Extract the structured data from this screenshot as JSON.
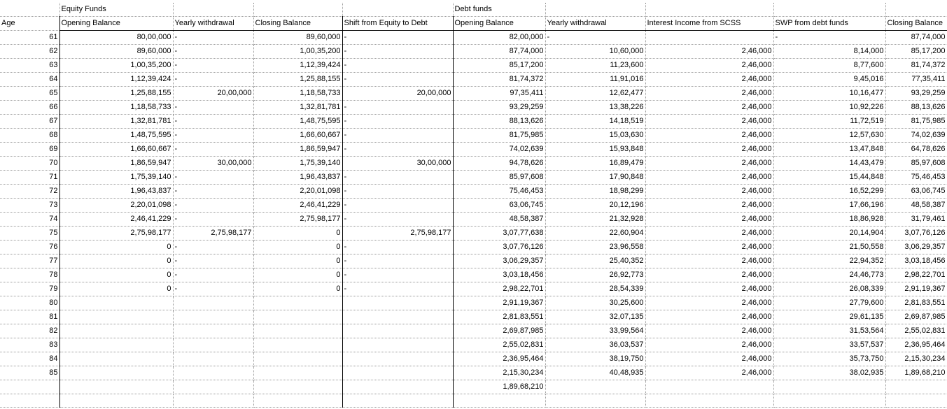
{
  "header_row1": {
    "equity_funds": "Equity Funds",
    "debt_funds": "Debt funds"
  },
  "columns": [
    "Age",
    "Opening Balance",
    "Yearly withdrawal",
    "Closing Balance",
    "Shift from Equity to Debt",
    "Opening Balance",
    "Yearly withdrawal",
    "Interest Income from SCSS",
    "SWP from debt funds",
    "Closing Balance"
  ],
  "rows": [
    [
      "61",
      "80,00,000",
      "-",
      "89,60,000",
      "-",
      "82,00,000",
      "-",
      "",
      "-",
      "87,74,000"
    ],
    [
      "62",
      "89,60,000",
      "-",
      "1,00,35,200",
      "-",
      "87,74,000",
      "10,60,000",
      "2,46,000",
      "8,14,000",
      "85,17,200"
    ],
    [
      "63",
      "1,00,35,200",
      "-",
      "1,12,39,424",
      "-",
      "85,17,200",
      "11,23,600",
      "2,46,000",
      "8,77,600",
      "81,74,372"
    ],
    [
      "64",
      "1,12,39,424",
      "-",
      "1,25,88,155",
      "-",
      "81,74,372",
      "11,91,016",
      "2,46,000",
      "9,45,016",
      "77,35,411"
    ],
    [
      "65",
      "1,25,88,155",
      "20,00,000",
      "1,18,58,733",
      "20,00,000",
      "97,35,411",
      "12,62,477",
      "2,46,000",
      "10,16,477",
      "93,29,259"
    ],
    [
      "66",
      "1,18,58,733",
      "-",
      "1,32,81,781",
      "-",
      "93,29,259",
      "13,38,226",
      "2,46,000",
      "10,92,226",
      "88,13,626"
    ],
    [
      "67",
      "1,32,81,781",
      "-",
      "1,48,75,595",
      "-",
      "88,13,626",
      "14,18,519",
      "2,46,000",
      "11,72,519",
      "81,75,985"
    ],
    [
      "68",
      "1,48,75,595",
      "-",
      "1,66,60,667",
      "-",
      "81,75,985",
      "15,03,630",
      "2,46,000",
      "12,57,630",
      "74,02,639"
    ],
    [
      "69",
      "1,66,60,667",
      "-",
      "1,86,59,947",
      "-",
      "74,02,639",
      "15,93,848",
      "2,46,000",
      "13,47,848",
      "64,78,626"
    ],
    [
      "70",
      "1,86,59,947",
      "30,00,000",
      "1,75,39,140",
      "30,00,000",
      "94,78,626",
      "16,89,479",
      "2,46,000",
      "14,43,479",
      "85,97,608"
    ],
    [
      "71",
      "1,75,39,140",
      "-",
      "1,96,43,837",
      "-",
      "85,97,608",
      "17,90,848",
      "2,46,000",
      "15,44,848",
      "75,46,453"
    ],
    [
      "72",
      "1,96,43,837",
      "-",
      "2,20,01,098",
      "-",
      "75,46,453",
      "18,98,299",
      "2,46,000",
      "16,52,299",
      "63,06,745"
    ],
    [
      "73",
      "2,20,01,098",
      "-",
      "2,46,41,229",
      "-",
      "63,06,745",
      "20,12,196",
      "2,46,000",
      "17,66,196",
      "48,58,387"
    ],
    [
      "74",
      "2,46,41,229",
      "-",
      "2,75,98,177",
      "-",
      "48,58,387",
      "21,32,928",
      "2,46,000",
      "18,86,928",
      "31,79,461"
    ],
    [
      "75",
      "2,75,98,177",
      "2,75,98,177",
      "0",
      "2,75,98,177",
      "3,07,77,638",
      "22,60,904",
      "2,46,000",
      "20,14,904",
      "3,07,76,126"
    ],
    [
      "76",
      "0",
      "-",
      "0",
      "-",
      "3,07,76,126",
      "23,96,558",
      "2,46,000",
      "21,50,558",
      "3,06,29,357"
    ],
    [
      "77",
      "0",
      "-",
      "0",
      "-",
      "3,06,29,357",
      "25,40,352",
      "2,46,000",
      "22,94,352",
      "3,03,18,456"
    ],
    [
      "78",
      "0",
      "-",
      "0",
      "-",
      "3,03,18,456",
      "26,92,773",
      "2,46,000",
      "24,46,773",
      "2,98,22,701"
    ],
    [
      "79",
      "0",
      "-",
      "0",
      "-",
      "2,98,22,701",
      "28,54,339",
      "2,46,000",
      "26,08,339",
      "2,91,19,367"
    ],
    [
      "80",
      "",
      "",
      "",
      "",
      "2,91,19,367",
      "30,25,600",
      "2,46,000",
      "27,79,600",
      "2,81,83,551"
    ],
    [
      "81",
      "",
      "",
      "",
      "",
      "2,81,83,551",
      "32,07,135",
      "2,46,000",
      "29,61,135",
      "2,69,87,985"
    ],
    [
      "82",
      "",
      "",
      "",
      "",
      "2,69,87,985",
      "33,99,564",
      "2,46,000",
      "31,53,564",
      "2,55,02,831"
    ],
    [
      "83",
      "",
      "",
      "",
      "",
      "2,55,02,831",
      "36,03,537",
      "2,46,000",
      "33,57,537",
      "2,36,95,464"
    ],
    [
      "84",
      "",
      "",
      "",
      "",
      "2,36,95,464",
      "38,19,750",
      "2,46,000",
      "35,73,750",
      "2,15,30,234"
    ],
    [
      "85",
      "",
      "",
      "",
      "",
      "2,15,30,234",
      "40,48,935",
      "2,46,000",
      "38,02,935",
      "1,89,68,210"
    ],
    [
      "",
      "",
      "",
      "",
      "",
      "1,89,68,210",
      "",
      "",
      "",
      ""
    ],
    [
      "",
      "",
      "",
      "",
      "",
      "",
      "",
      "",
      "",
      ""
    ]
  ]
}
